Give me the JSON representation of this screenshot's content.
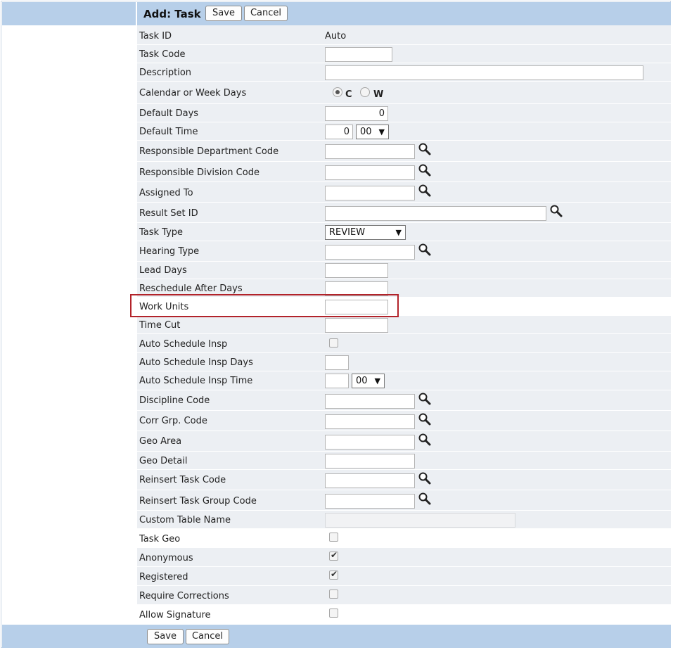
{
  "header": {
    "title": "Add: Task",
    "save_label": "Save",
    "cancel_label": "Cancel"
  },
  "footer": {
    "save_label": "Save",
    "cancel_label": "Cancel"
  },
  "fields": {
    "task_id": {
      "label": "Task ID",
      "value": "Auto"
    },
    "task_code": {
      "label": "Task Code",
      "value": ""
    },
    "description": {
      "label": "Description",
      "value": ""
    },
    "calendar_days": {
      "label": "Calendar or Week Days",
      "option_c": "C",
      "option_w": "W",
      "selected": "C"
    },
    "default_days": {
      "label": "Default Days",
      "value": "0"
    },
    "default_time": {
      "label": "Default Time",
      "hours": "0",
      "minutes": "00"
    },
    "resp_dept": {
      "label": "Responsible Department Code",
      "value": ""
    },
    "resp_div": {
      "label": "Responsible Division Code",
      "value": ""
    },
    "assigned_to": {
      "label": "Assigned To",
      "value": ""
    },
    "result_set": {
      "label": "Result Set ID",
      "value": ""
    },
    "task_type": {
      "label": "Task Type",
      "value": "REVIEW"
    },
    "hearing_type": {
      "label": "Hearing Type",
      "value": ""
    },
    "lead_days": {
      "label": "Lead Days",
      "value": ""
    },
    "reschedule": {
      "label": "Reschedule After Days",
      "value": ""
    },
    "work_units": {
      "label": "Work Units",
      "value": ""
    },
    "time_cut": {
      "label": "Time Cut",
      "value": ""
    },
    "auto_sched": {
      "label": "Auto Schedule Insp",
      "checked": false
    },
    "auto_sched_days": {
      "label": "Auto Schedule Insp Days",
      "value": ""
    },
    "auto_sched_time": {
      "label": "Auto Schedule Insp Time",
      "hours": "",
      "minutes": "00"
    },
    "discipline": {
      "label": "Discipline Code",
      "value": ""
    },
    "corr_grp": {
      "label": "Corr Grp. Code",
      "value": ""
    },
    "geo_area": {
      "label": "Geo Area",
      "value": ""
    },
    "geo_detail": {
      "label": "Geo Detail",
      "value": ""
    },
    "reinsert_task": {
      "label": "Reinsert Task Code",
      "value": ""
    },
    "reinsert_group": {
      "label": "Reinsert Task Group Code",
      "value": ""
    },
    "custom_table": {
      "label": "Custom Table Name",
      "value": ""
    },
    "task_geo": {
      "label": "Task Geo",
      "checked": false
    },
    "anonymous": {
      "label": "Anonymous",
      "checked": true
    },
    "registered": {
      "label": "Registered",
      "checked": true
    },
    "require_corr": {
      "label": "Require Corrections",
      "checked": false
    },
    "allow_sig": {
      "label": "Allow Signature",
      "checked": false
    }
  },
  "colors": {
    "header_bar": "#b7cfe9",
    "row_alt": "#eceff3",
    "highlight": "#b2232a"
  }
}
